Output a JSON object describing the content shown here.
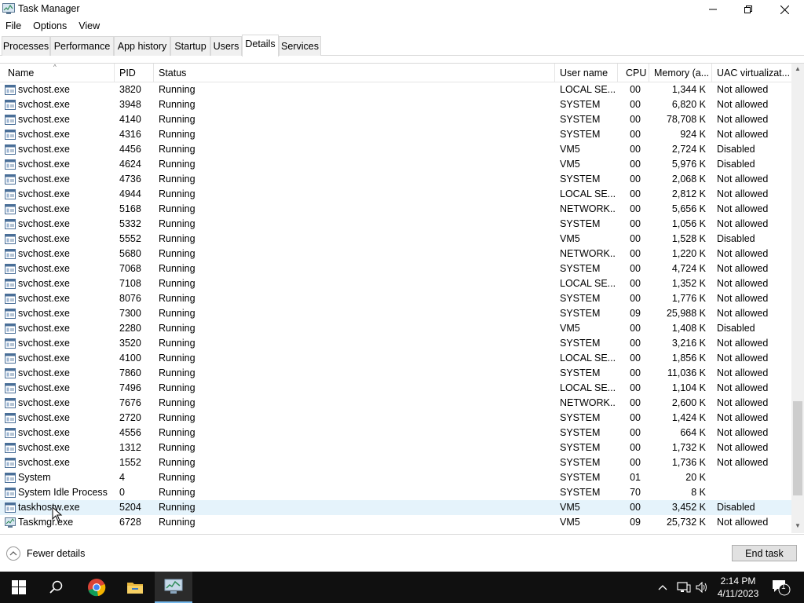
{
  "window": {
    "title": "Task Manager",
    "menu": [
      "File",
      "Options",
      "View"
    ]
  },
  "tabs": [
    {
      "label": "Processes",
      "active": false
    },
    {
      "label": "Performance",
      "active": false
    },
    {
      "label": "App history",
      "active": false
    },
    {
      "label": "Startup",
      "active": false
    },
    {
      "label": "Users",
      "active": false
    },
    {
      "label": "Details",
      "active": true
    },
    {
      "label": "Services",
      "active": false
    }
  ],
  "columns": {
    "name": "Name",
    "pid": "PID",
    "status": "Status",
    "user": "User name",
    "cpu": "CPU",
    "memory": "Memory (a...",
    "uac": "UAC virtualizat..."
  },
  "rows": [
    {
      "name": "svchost.exe",
      "pid": "3820",
      "status": "Running",
      "user": "LOCAL SE...",
      "cpu": "00",
      "mem": "1,344 K",
      "uac": "Not allowed"
    },
    {
      "name": "svchost.exe",
      "pid": "3948",
      "status": "Running",
      "user": "SYSTEM",
      "cpu": "00",
      "mem": "6,820 K",
      "uac": "Not allowed"
    },
    {
      "name": "svchost.exe",
      "pid": "4140",
      "status": "Running",
      "user": "SYSTEM",
      "cpu": "00",
      "mem": "78,708 K",
      "uac": "Not allowed"
    },
    {
      "name": "svchost.exe",
      "pid": "4316",
      "status": "Running",
      "user": "SYSTEM",
      "cpu": "00",
      "mem": "924 K",
      "uac": "Not allowed"
    },
    {
      "name": "svchost.exe",
      "pid": "4456",
      "status": "Running",
      "user": "VM5",
      "cpu": "00",
      "mem": "2,724 K",
      "uac": "Disabled"
    },
    {
      "name": "svchost.exe",
      "pid": "4624",
      "status": "Running",
      "user": "VM5",
      "cpu": "00",
      "mem": "5,976 K",
      "uac": "Disabled"
    },
    {
      "name": "svchost.exe",
      "pid": "4736",
      "status": "Running",
      "user": "SYSTEM",
      "cpu": "00",
      "mem": "2,068 K",
      "uac": "Not allowed"
    },
    {
      "name": "svchost.exe",
      "pid": "4944",
      "status": "Running",
      "user": "LOCAL SE...",
      "cpu": "00",
      "mem": "2,812 K",
      "uac": "Not allowed"
    },
    {
      "name": "svchost.exe",
      "pid": "5168",
      "status": "Running",
      "user": "NETWORK...",
      "cpu": "00",
      "mem": "5,656 K",
      "uac": "Not allowed"
    },
    {
      "name": "svchost.exe",
      "pid": "5332",
      "status": "Running",
      "user": "SYSTEM",
      "cpu": "00",
      "mem": "1,056 K",
      "uac": "Not allowed"
    },
    {
      "name": "svchost.exe",
      "pid": "5552",
      "status": "Running",
      "user": "VM5",
      "cpu": "00",
      "mem": "1,528 K",
      "uac": "Disabled"
    },
    {
      "name": "svchost.exe",
      "pid": "5680",
      "status": "Running",
      "user": "NETWORK...",
      "cpu": "00",
      "mem": "1,220 K",
      "uac": "Not allowed"
    },
    {
      "name": "svchost.exe",
      "pid": "7068",
      "status": "Running",
      "user": "SYSTEM",
      "cpu": "00",
      "mem": "4,724 K",
      "uac": "Not allowed"
    },
    {
      "name": "svchost.exe",
      "pid": "7108",
      "status": "Running",
      "user": "LOCAL SE...",
      "cpu": "00",
      "mem": "1,352 K",
      "uac": "Not allowed"
    },
    {
      "name": "svchost.exe",
      "pid": "8076",
      "status": "Running",
      "user": "SYSTEM",
      "cpu": "00",
      "mem": "1,776 K",
      "uac": "Not allowed"
    },
    {
      "name": "svchost.exe",
      "pid": "7300",
      "status": "Running",
      "user": "SYSTEM",
      "cpu": "09",
      "mem": "25,988 K",
      "uac": "Not allowed"
    },
    {
      "name": "svchost.exe",
      "pid": "2280",
      "status": "Running",
      "user": "VM5",
      "cpu": "00",
      "mem": "1,408 K",
      "uac": "Disabled"
    },
    {
      "name": "svchost.exe",
      "pid": "3520",
      "status": "Running",
      "user": "SYSTEM",
      "cpu": "00",
      "mem": "3,216 K",
      "uac": "Not allowed"
    },
    {
      "name": "svchost.exe",
      "pid": "4100",
      "status": "Running",
      "user": "LOCAL SE...",
      "cpu": "00",
      "mem": "1,856 K",
      "uac": "Not allowed"
    },
    {
      "name": "svchost.exe",
      "pid": "7860",
      "status": "Running",
      "user": "SYSTEM",
      "cpu": "00",
      "mem": "11,036 K",
      "uac": "Not allowed"
    },
    {
      "name": "svchost.exe",
      "pid": "7496",
      "status": "Running",
      "user": "LOCAL SE...",
      "cpu": "00",
      "mem": "1,104 K",
      "uac": "Not allowed"
    },
    {
      "name": "svchost.exe",
      "pid": "7676",
      "status": "Running",
      "user": "NETWORK...",
      "cpu": "00",
      "mem": "2,600 K",
      "uac": "Not allowed"
    },
    {
      "name": "svchost.exe",
      "pid": "2720",
      "status": "Running",
      "user": "SYSTEM",
      "cpu": "00",
      "mem": "1,424 K",
      "uac": "Not allowed"
    },
    {
      "name": "svchost.exe",
      "pid": "4556",
      "status": "Running",
      "user": "SYSTEM",
      "cpu": "00",
      "mem": "664 K",
      "uac": "Not allowed"
    },
    {
      "name": "svchost.exe",
      "pid": "1312",
      "status": "Running",
      "user": "SYSTEM",
      "cpu": "00",
      "mem": "1,732 K",
      "uac": "Not allowed"
    },
    {
      "name": "svchost.exe",
      "pid": "1552",
      "status": "Running",
      "user": "SYSTEM",
      "cpu": "00",
      "mem": "1,736 K",
      "uac": "Not allowed"
    },
    {
      "name": "System",
      "pid": "4",
      "status": "Running",
      "user": "SYSTEM",
      "cpu": "01",
      "mem": "20 K",
      "uac": ""
    },
    {
      "name": "System Idle Process",
      "pid": "0",
      "status": "Running",
      "user": "SYSTEM",
      "cpu": "70",
      "mem": "8 K",
      "uac": ""
    },
    {
      "name": "taskhostw.exe",
      "pid": "5204",
      "status": "Running",
      "user": "VM5",
      "cpu": "00",
      "mem": "3,452 K",
      "uac": "Disabled",
      "hover": true
    },
    {
      "name": "Taskmgr.exe",
      "pid": "6728",
      "status": "Running",
      "user": "VM5",
      "cpu": "09",
      "mem": "25,732 K",
      "uac": "Not allowed",
      "icon": "taskmgr"
    }
  ],
  "footer": {
    "fewer_details": "Fewer details",
    "end_task": "End task"
  },
  "taskbar": {
    "time": "2:14 PM",
    "date": "4/11/2023",
    "notification_count": "1",
    "apps": [
      "start-icon",
      "search-icon",
      "chrome-icon",
      "file-explorer-icon",
      "task-manager-icon"
    ]
  },
  "colors": {
    "taskbar": "#101010",
    "hover_row": "#e5f3fb",
    "active_task_underline": "#76b9ed"
  }
}
